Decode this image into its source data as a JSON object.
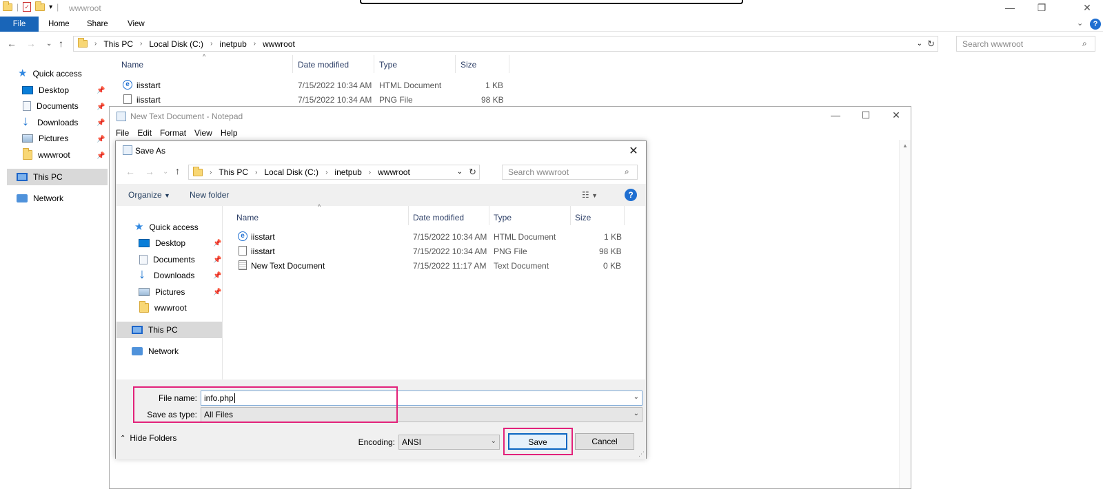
{
  "explorer": {
    "title": "wwwroot",
    "ribbon_tabs": [
      "File",
      "Home",
      "Share",
      "View"
    ],
    "address": [
      "This PC",
      "Local Disk (C:)",
      "inetpub",
      "wwwroot"
    ],
    "search_placeholder": "Search wwwroot",
    "sidebar": [
      {
        "label": "Quick access",
        "icon": "star-icon"
      },
      {
        "label": "Desktop",
        "icon": "desktop-icon",
        "pinned": true
      },
      {
        "label": "Documents",
        "icon": "documents-icon",
        "pinned": true
      },
      {
        "label": "Downloads",
        "icon": "downloads-icon",
        "pinned": true
      },
      {
        "label": "Pictures",
        "icon": "pictures-icon",
        "pinned": true
      },
      {
        "label": "wwwroot",
        "icon": "folder-icon",
        "pinned": true
      },
      {
        "label": "This PC",
        "icon": "this-pc-icon",
        "selected": true
      },
      {
        "label": "Network",
        "icon": "network-icon"
      }
    ],
    "columns": [
      "Name",
      "Date modified",
      "Type",
      "Size"
    ],
    "files": [
      {
        "name": "iisstart",
        "date": "7/15/2022 10:34 AM",
        "type": "HTML Document",
        "size": "1 KB"
      },
      {
        "name": "iisstart",
        "date": "7/15/2022 10:34 AM",
        "type": "PNG File",
        "size": "98 KB"
      }
    ]
  },
  "notepad": {
    "title": "New Text Document - Notepad",
    "menu": [
      "File",
      "Edit",
      "Format",
      "View",
      "Help"
    ]
  },
  "saveas": {
    "title": "Save As",
    "address": [
      "This PC",
      "Local Disk (C:)",
      "inetpub",
      "wwwroot"
    ],
    "search_placeholder": "Search wwwroot",
    "organize": "Organize",
    "new_folder": "New folder",
    "sidebar": [
      {
        "label": "Quick access"
      },
      {
        "label": "Desktop"
      },
      {
        "label": "Documents"
      },
      {
        "label": "Downloads"
      },
      {
        "label": "Pictures"
      },
      {
        "label": "wwwroot"
      },
      {
        "label": "This PC"
      },
      {
        "label": "Network"
      }
    ],
    "columns": [
      "Name",
      "Date modified",
      "Type",
      "Size"
    ],
    "files": [
      {
        "name": "iisstart",
        "date": "7/15/2022 10:34 AM",
        "type": "HTML Document",
        "size": "1 KB"
      },
      {
        "name": "iisstart",
        "date": "7/15/2022 10:34 AM",
        "type": "PNG File",
        "size": "98 KB"
      },
      {
        "name": "New Text Document",
        "date": "7/15/2022 11:17 AM",
        "type": "Text Document",
        "size": "0 KB"
      }
    ],
    "file_name_label": "File name:",
    "file_name_value": "info.php",
    "save_type_label": "Save as type:",
    "save_type_value": "All Files",
    "encoding_label": "Encoding:",
    "encoding_value": "ANSI",
    "save_button": "Save",
    "cancel_button": "Cancel",
    "hide_folders": "Hide Folders"
  },
  "colors": {
    "accent": "#1965b8",
    "highlight": "#e2217a"
  }
}
